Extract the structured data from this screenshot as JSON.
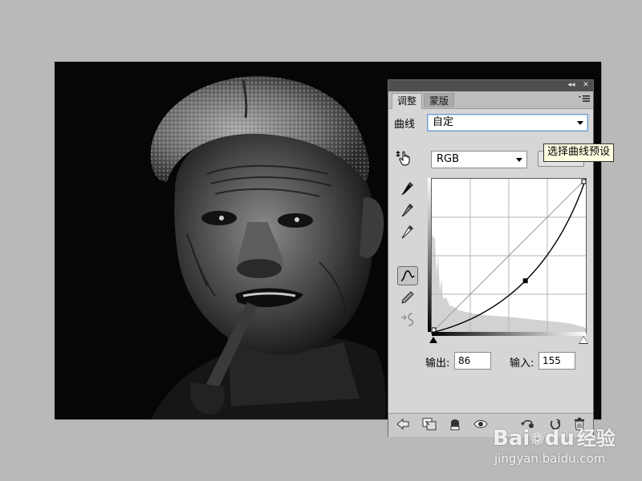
{
  "panel": {
    "titlebar_buttons": {
      "collapse": "◂◂",
      "close": "✕"
    },
    "tabs": [
      {
        "label": "调整",
        "active": true
      },
      {
        "label": "蒙版",
        "active": false
      }
    ],
    "menu_icon": "panel-menu-icon"
  },
  "curves": {
    "label": "曲线",
    "preset_value": "自定",
    "channel_value": "RGB",
    "output_label": "输出:",
    "output_value": "86",
    "input_label": "输入:",
    "input_value": "155",
    "control_point": {
      "input": 155,
      "output": 86
    }
  },
  "tooltip": {
    "text": "选择曲线预设"
  },
  "tools": [
    "on-image-adjust-icon",
    "black-point-eyedropper-icon",
    "gray-point-eyedropper-icon",
    "white-point-eyedropper-icon",
    "curve-point-edit-icon",
    "pencil-draw-icon",
    "smooth-curve-icon"
  ],
  "bottom_tools": [
    "back-arrow-icon",
    "clip-to-layer-icon",
    "mask-visibility-icon",
    "eye-visibility-icon",
    "previous-state-icon",
    "reset-icon",
    "trash-icon"
  ],
  "watermark": {
    "brand_left": "Bai",
    "brand_right": "du",
    "brand_suffix": "经验",
    "url": "jingyan.baidu.com"
  }
}
